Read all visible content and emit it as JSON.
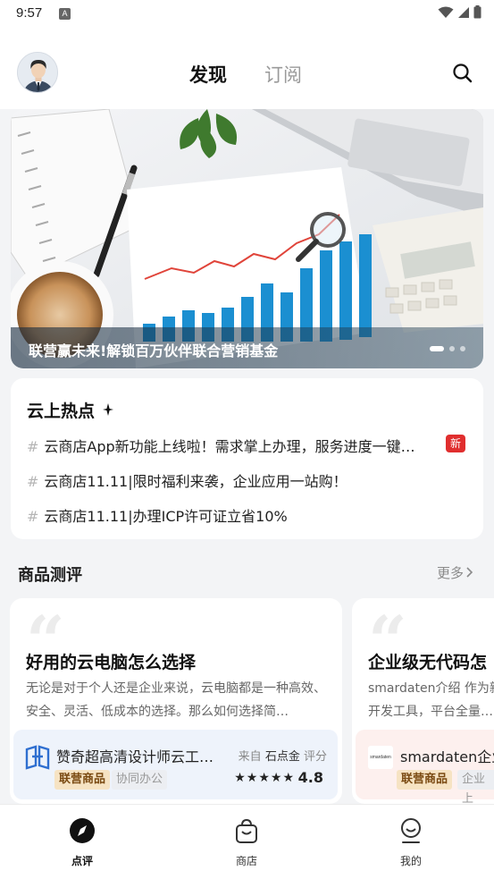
{
  "status_bar": {
    "time": "9:57",
    "notification_letter": "A"
  },
  "header": {
    "tabs": [
      {
        "label": "发现",
        "active": true
      },
      {
        "label": "订阅",
        "active": false
      }
    ],
    "search_icon": "search-icon",
    "avatar_icon": "user-avatar"
  },
  "banner": {
    "caption": "联营赢未来!解锁百万伙伴联合营销基金",
    "slide_count": 3,
    "active_slide": 1,
    "image_icon": "office-chart-photo"
  },
  "hot": {
    "title": "云上热点",
    "items": [
      {
        "text": "云商店App新功能上线啦！需求掌上办理，服务进度一键…",
        "badge": "新"
      },
      {
        "text": "云商店11.11|限时福利来袭，企业应用一站购！",
        "badge": ""
      },
      {
        "text": "云商店11.11|办理ICP许可证立省10%",
        "badge": ""
      }
    ],
    "hash": "#"
  },
  "reviews_section": {
    "title": "商品测评",
    "more": "更多"
  },
  "reviews": [
    {
      "title": "好用的云电脑怎么选择",
      "desc": "无论是对于个人还是企业来说，云电脑都是一种高效、安全、灵活、低成本的选择。那么如何选择简…",
      "product_name": "赞奇超高清设计师云工…",
      "source_prefix": "来自",
      "source_name": "石点金",
      "source_suffix": "评分",
      "tag_primary": "联营商品",
      "tag_secondary": "协同办公",
      "rating": 4.8,
      "rating_text": "4.8",
      "stars": "★★★★★",
      "logo_icon": "zanqi-logo-icon",
      "box_color": "#eef3fb"
    },
    {
      "title": "企业级无代码怎",
      "desc": "smardaten介绍 作为新 开发工具，平台全量…",
      "product_name": "smardaten企业",
      "tag_primary": "联营商品",
      "tag_secondary": "企业上",
      "logo_text": "smardaten",
      "box_color": "#fdf0ee"
    }
  ],
  "bottom_nav": [
    {
      "label": "点评",
      "icon": "compass-icon",
      "active": true
    },
    {
      "label": "商店",
      "icon": "shopping-bag-icon",
      "active": false
    },
    {
      "label": "我的",
      "icon": "profile-icon",
      "active": false
    }
  ]
}
